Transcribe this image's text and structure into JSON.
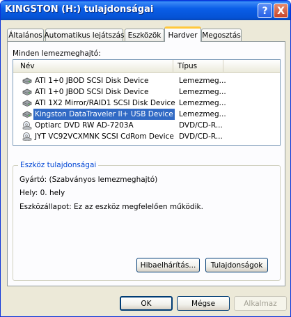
{
  "window": {
    "title": "KINGSTON (H:) tulajdonságai"
  },
  "titlebar_buttons": {
    "help": "?",
    "close": "X"
  },
  "tabs": [
    {
      "label": "Általános"
    },
    {
      "label": "Automatikus lejátszás"
    },
    {
      "label": "Eszközök"
    },
    {
      "label": "Hardver",
      "active": true
    },
    {
      "label": "Megosztás"
    }
  ],
  "hardware": {
    "all_drives_label": "Minden lemezmeghajtó:",
    "columns": [
      "Név",
      "Típus"
    ],
    "rows": [
      {
        "name": "ATI 1+0 JBOD SCSI Disk Device",
        "type": "Lemezmeg...",
        "icon": "disk-drive-icon"
      },
      {
        "name": "ATI 1+0 JBOD SCSI Disk Device",
        "type": "Lemezmeg...",
        "icon": "disk-drive-icon"
      },
      {
        "name": "ATI 1X2 Mirror/RAID1 SCSI Disk Device",
        "type": "Lemezmeg...",
        "icon": "disk-drive-icon"
      },
      {
        "name": "Kingston DataTraveler II+ USB Device",
        "type": "Lemezmeg...",
        "icon": "disk-drive-icon",
        "selected": true
      },
      {
        "name": "Optiarc DVD RW AD-7203A",
        "type": "DVD/CD-R...",
        "icon": "cd-drive-icon"
      },
      {
        "name": "JYT VC92VCXMNK SCSI CdRom Device",
        "type": "DVD/CD-R...",
        "icon": "cd-drive-icon"
      }
    ]
  },
  "device_properties": {
    "title": "Eszköz tulajdonságai",
    "manufacturer": "Gyártó: (Szabványos lemezmeghajtó)",
    "location": "Hely: 0. hely",
    "status": "Eszközállapot: Ez az eszköz megfelelően működik.",
    "troubleshoot_button": "Hibaelhárítás...",
    "properties_button": "Tulajdonságok"
  },
  "dialog_buttons": {
    "ok": "OK",
    "cancel": "Mégse",
    "apply": "Alkalmaz"
  },
  "colors": {
    "selection": "#316ac5",
    "titlebar": "#0a5ee8",
    "group_title": "#0046d5",
    "active_tab_accent": "#ffc83c"
  }
}
